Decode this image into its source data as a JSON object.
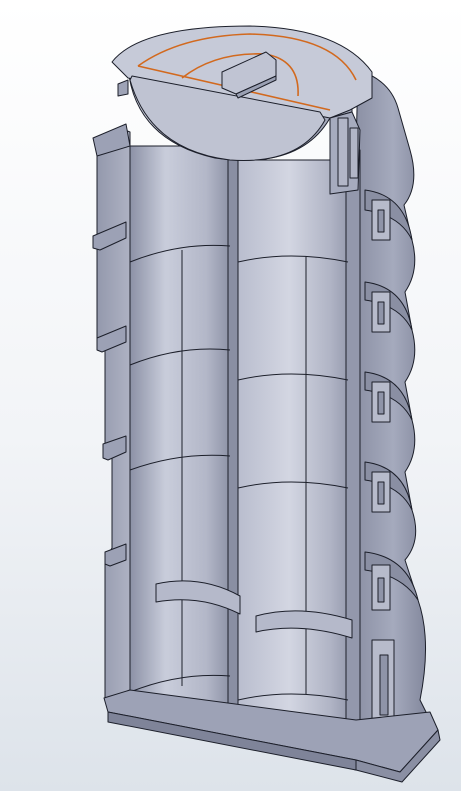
{
  "viewport": {
    "background_top": "#ffffff",
    "background_bottom": "#dde3ea"
  },
  "model": {
    "body_color": "#a3a8bb",
    "face_light": "#c4c8d6",
    "face_mid": "#9ea3b6",
    "face_dark": "#7d8297",
    "edge_color": "#1c1f2a",
    "highlight_edge_color": "#d2691e",
    "shell_ribs": 5,
    "columns": 2,
    "icons": [
      "cutaway-model",
      "dome-cap",
      "selected-edge-highlight"
    ]
  }
}
